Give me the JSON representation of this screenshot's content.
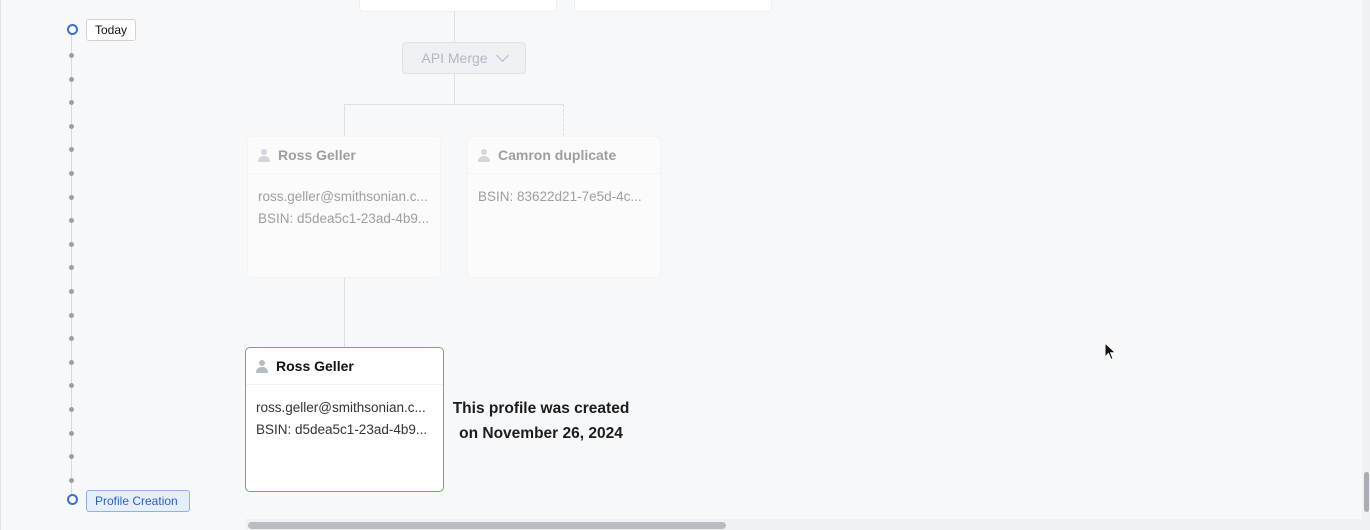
{
  "timeline": {
    "today_label": "Today",
    "profile_creation_label": "Profile Creation"
  },
  "merge_button": {
    "label": "API Merge",
    "icon": "chevron-down-icon"
  },
  "cards": {
    "ross_merged": {
      "name": "Ross Geller",
      "email": "ross.geller@smithsonian.c...",
      "bsin": "BSIN: d5dea5c1-23ad-4b9..."
    },
    "camron": {
      "name": "Camron duplicate",
      "bsin": "BSIN: 83622d21-7e5d-4c..."
    },
    "ross_created": {
      "name": "Ross Geller",
      "email": "ross.geller@smithsonian.c...",
      "bsin": "BSIN: d5dea5c1-23ad-4b9..."
    }
  },
  "note": {
    "line1": "This profile was created",
    "line2": "on November 26, 2024"
  },
  "colors": {
    "accent": "#3a6fd8",
    "active_border": "#6f95df",
    "tag_bg": "#e6eefb"
  }
}
